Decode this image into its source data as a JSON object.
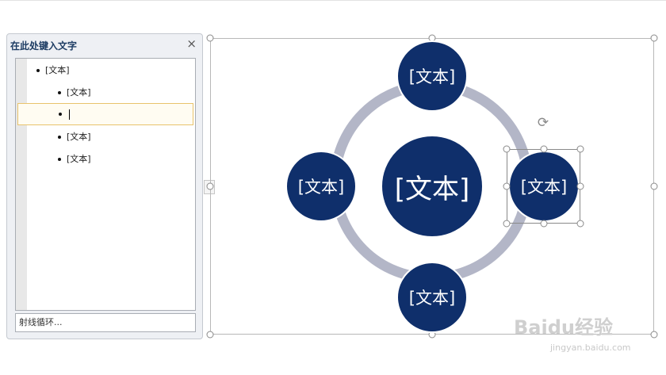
{
  "text_pane": {
    "title": "在此处键入文字",
    "close_glyph": "×",
    "items": [
      {
        "text": "[文本]",
        "level": 1
      },
      {
        "text": "[文本]",
        "level": 2
      },
      {
        "text": "",
        "level": 2,
        "editing": true
      },
      {
        "text": "[文本]",
        "level": 2
      },
      {
        "text": "[文本]",
        "level": 2
      }
    ],
    "layout_name": "射线循环..."
  },
  "expander_glyph": "›",
  "diagram": {
    "center_label": "[文本]",
    "top_label": "[文本]",
    "left_label": "[文本]",
    "right_label": "[文本]",
    "bottom_label": "[文本]",
    "rotate_glyph": "⟳",
    "fill_color": "#0f2f6b",
    "ring_color": "#b3b6c7"
  },
  "watermark": {
    "main": "Baidu经验",
    "sub": "jingyan.baidu.com"
  }
}
